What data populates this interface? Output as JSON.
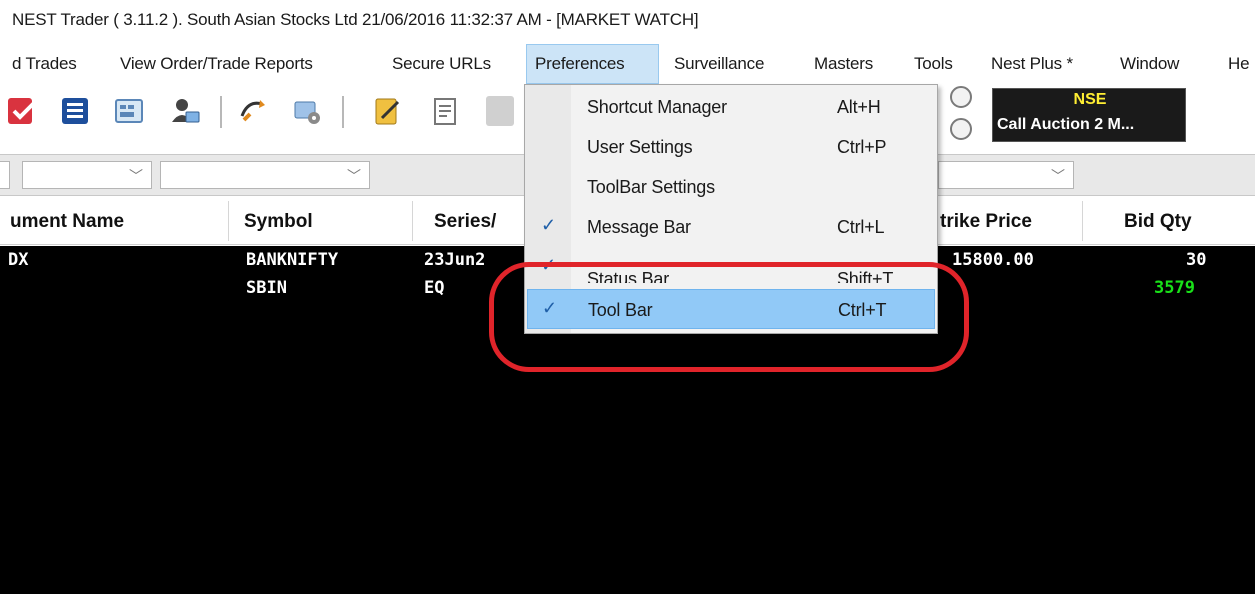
{
  "window": {
    "title": "NEST Trader ( 3.11.2 ).  South Asian Stocks Ltd  21/06/2016  11:32:37 AM - [MARKET WATCH]"
  },
  "menubar": {
    "items": [
      {
        "label": "d Trades"
      },
      {
        "label": "View Order/Trade Reports"
      },
      {
        "label": "Secure URLs"
      },
      {
        "label": "Preferences"
      },
      {
        "label": "Surveillance"
      },
      {
        "label": "Masters"
      },
      {
        "label": "Tools"
      },
      {
        "label": "Nest Plus *"
      },
      {
        "label": "Window"
      },
      {
        "label": "He"
      }
    ]
  },
  "exchange_status": {
    "exchange": "NSE",
    "session": "Call Auction 2 M..."
  },
  "icons": {
    "toolbar": [
      "order-check-icon",
      "list-icon",
      "calculator-icon",
      "user-card-icon",
      "transfer-icon",
      "settings-card-icon",
      "notepad-icon",
      "report-icon"
    ],
    "combo": "chevron-down-icon",
    "check": "checkmark-icon"
  },
  "grid": {
    "columns": [
      {
        "label": "ument Name"
      },
      {
        "label": "Symbol"
      },
      {
        "label": "Series/"
      },
      {
        "label": "trike Price"
      },
      {
        "label": "Bid Qty"
      }
    ],
    "rows": [
      {
        "instrument": "DX",
        "symbol": "BANKNIFTY",
        "series": "23Jun2",
        "strike": "15800.00",
        "bid_qty": "30"
      },
      {
        "instrument": "",
        "symbol": "SBIN",
        "series": "EQ",
        "strike": "",
        "bid_qty": "3579"
      }
    ]
  },
  "preferences_menu": {
    "items": [
      {
        "label": "Shortcut Manager",
        "shortcut": "Alt+H",
        "checked": false
      },
      {
        "label": "User Settings",
        "shortcut": "Ctrl+P",
        "checked": false
      },
      {
        "label": "ToolBar Settings",
        "shortcut": "",
        "checked": false
      },
      {
        "label": "Message Bar",
        "shortcut": "Ctrl+L",
        "checked": true
      },
      {
        "label": "Status Bar",
        "shortcut": "Shift+T",
        "checked": true
      },
      {
        "label": "Tool Bar",
        "shortcut": "Ctrl+T",
        "checked": true
      }
    ]
  },
  "colors": {
    "menu_highlight": "#91c9f7",
    "annotation": "#e0242a",
    "grid_background": "#000000",
    "bid_qty_green": "#19e019",
    "nse_yellow": "#ffee33"
  }
}
